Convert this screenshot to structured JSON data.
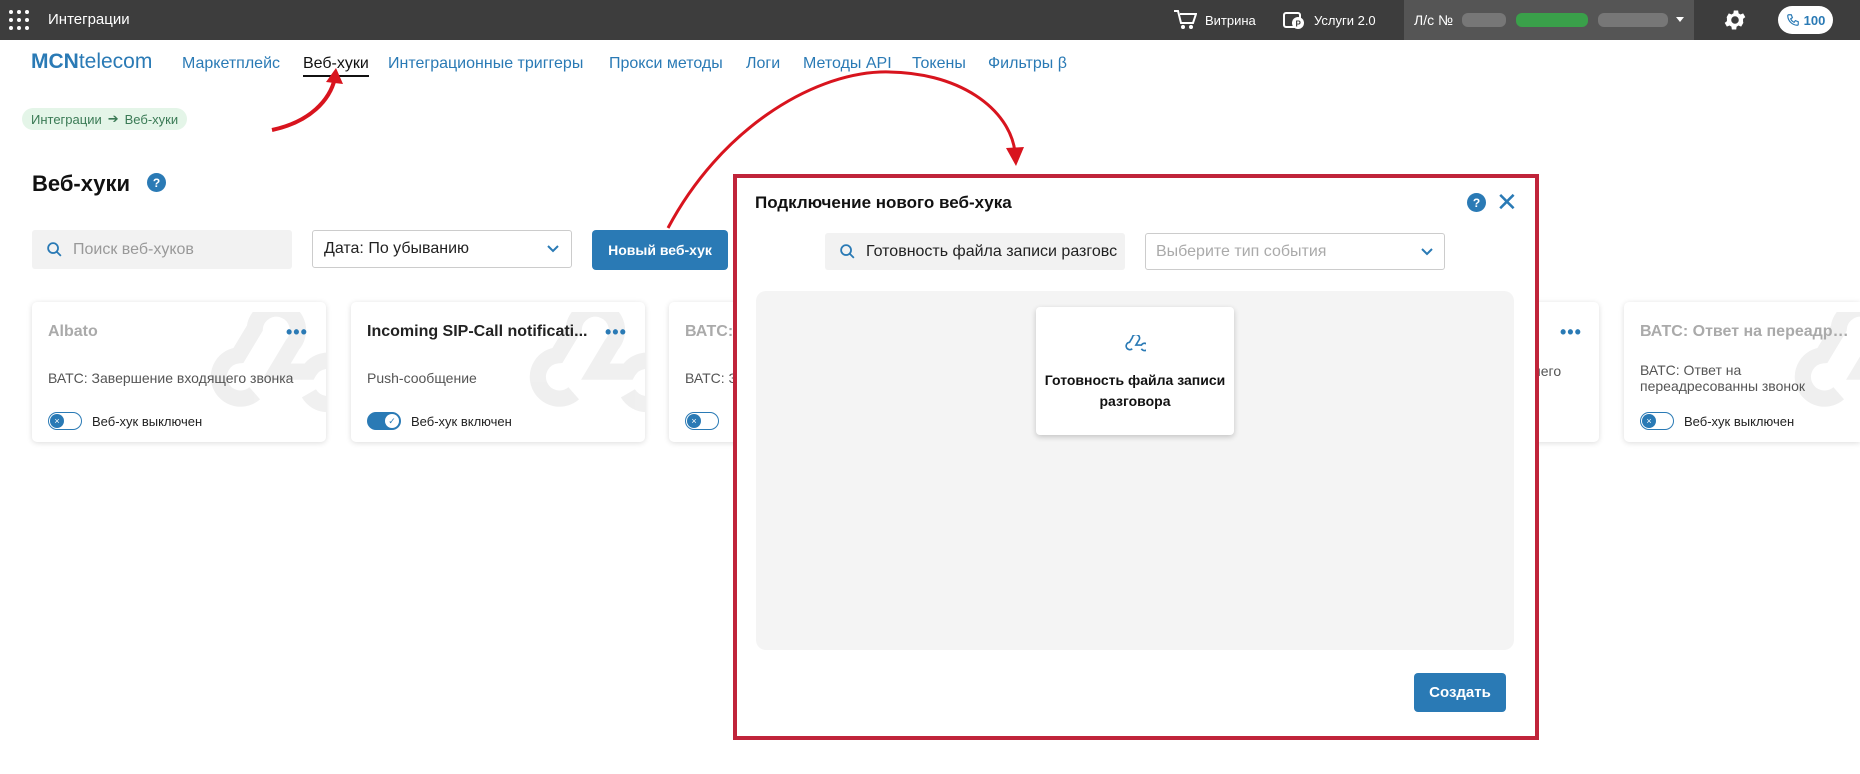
{
  "topbar": {
    "title": "Интеграции",
    "vitrina": "Витрина",
    "services": "Услуги 2.0",
    "account_label": "Л/с №",
    "phone_count": "100"
  },
  "nav": {
    "logo_bold": "MCN",
    "logo_rest": "telecom",
    "items": [
      "Маркетплейс",
      "Веб-хуки",
      "Интеграционные триггеры",
      "Прокси методы",
      "Логи",
      "Методы API",
      "Токены",
      "Фильтры β"
    ],
    "active_index": 1
  },
  "breadcrumb": {
    "parent": "Интеграции",
    "current": "Веб-хуки"
  },
  "page": {
    "title": "Веб-хуки",
    "search_placeholder": "Поиск веб-хуков",
    "sort_value": "Дата: По убыванию",
    "new_button": "Новый веб-хук"
  },
  "cards": [
    {
      "title": "Albato",
      "subtitle": "ВАТС: Завершение входящего звонка",
      "status": "Веб-хук выключен",
      "enabled": false
    },
    {
      "title": "Incoming SIP-Call notificati...",
      "subtitle": "Push-сообщение",
      "status": "Веб-хук включен",
      "enabled": true
    },
    {
      "title": "ВАТС:",
      "subtitle": "ВАТС: З",
      "status": "",
      "enabled": false
    },
    {
      "title": "",
      "subtitle": "него",
      "status": "",
      "enabled": false
    },
    {
      "title": "ВАТС: Ответ на переадрес...",
      "subtitle": "ВАТС: Ответ на переадресованны звонок",
      "status": "Веб-хук выключен",
      "enabled": false
    }
  ],
  "modal": {
    "title": "Подключение нового веб-хука",
    "search_value": "Готовность файла записи разговс",
    "type_placeholder": "Выберите тип события",
    "event_label": "Готовность файла записи разговора",
    "create_button": "Создать"
  },
  "colors": {
    "accent": "#2a7ab5",
    "highlight_border": "#c0243a",
    "topbar": "#3d3d3d"
  }
}
